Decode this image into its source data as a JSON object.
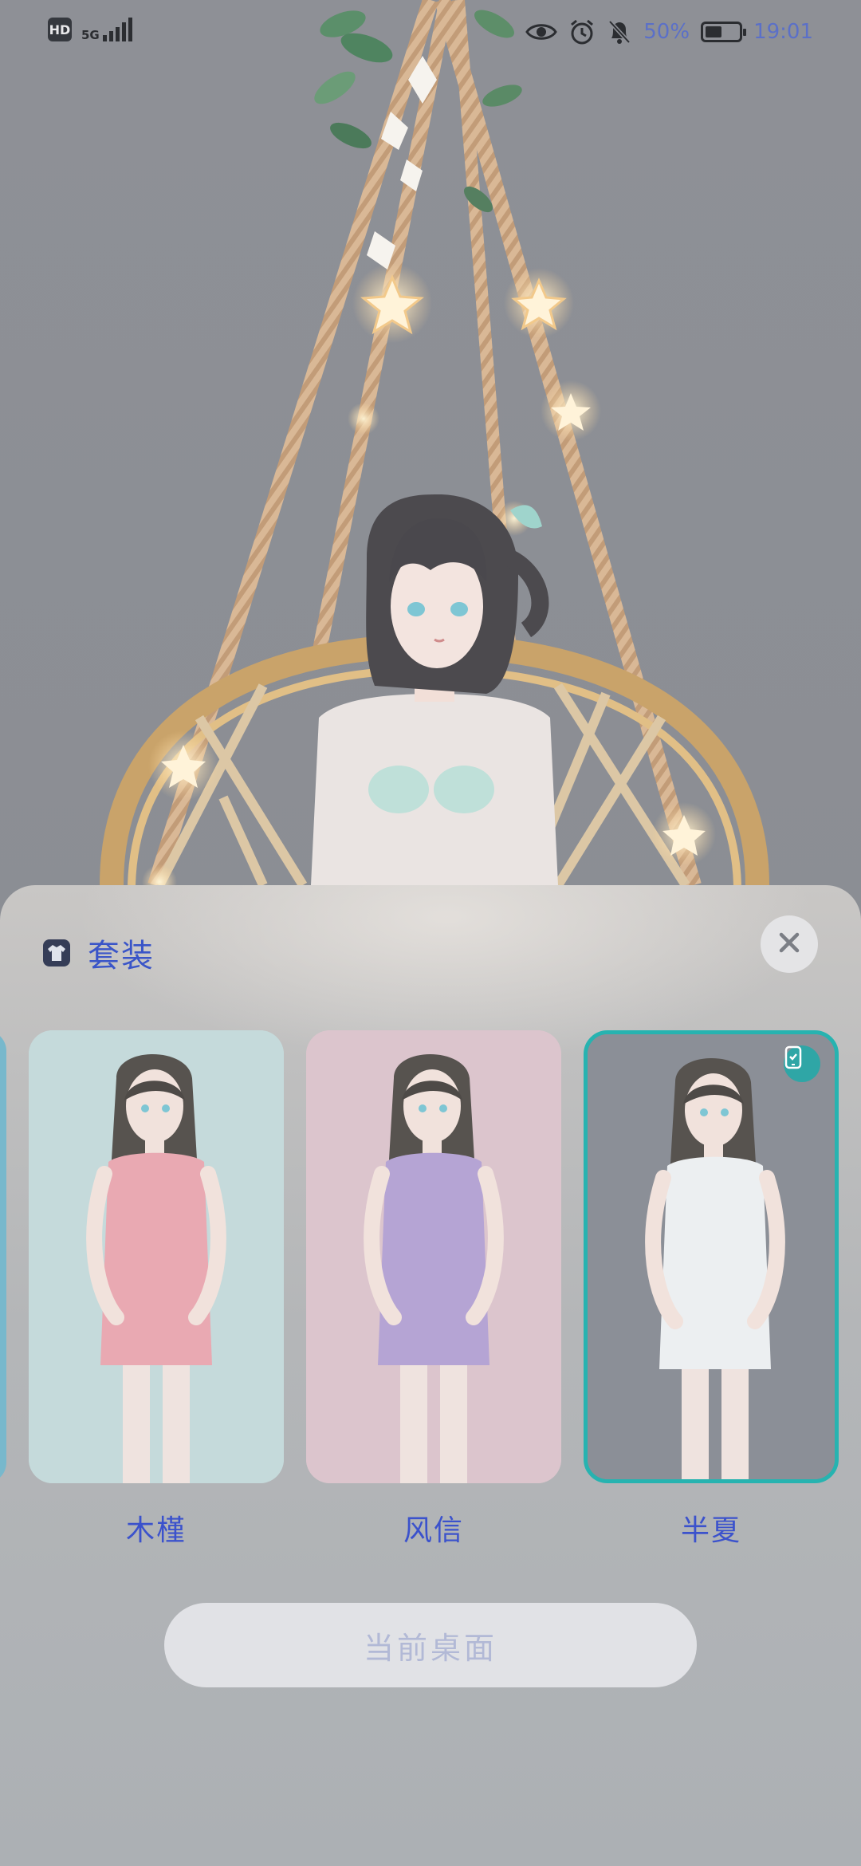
{
  "status_bar": {
    "hd_label": "HD",
    "network_label": "5G",
    "battery_text": "50%",
    "battery_level": 0.5,
    "time": "19:01",
    "icons": [
      "eye-icon",
      "alarm-icon",
      "bell-off-icon",
      "battery-icon"
    ]
  },
  "sheet": {
    "title": "套装",
    "title_icon": "shirt-icon",
    "close_icon": "close-icon",
    "outfits": [
      {
        "name": "木槿",
        "bg": "#c5dadb",
        "outfit_color": "#e9a9b2",
        "selected": false
      },
      {
        "name": "风信",
        "bg": "#dcc5cd",
        "outfit_color": "#b5a4d4",
        "selected": false
      },
      {
        "name": "半夏",
        "bg": "#8b8f97",
        "outfit_color": "#eceff1",
        "selected": true
      }
    ],
    "primary_button": "当前桌面"
  },
  "colors": {
    "accent": "#3b52cc",
    "selected_border": "#27b3b0",
    "wallpaper_bg": "#8e9096"
  }
}
